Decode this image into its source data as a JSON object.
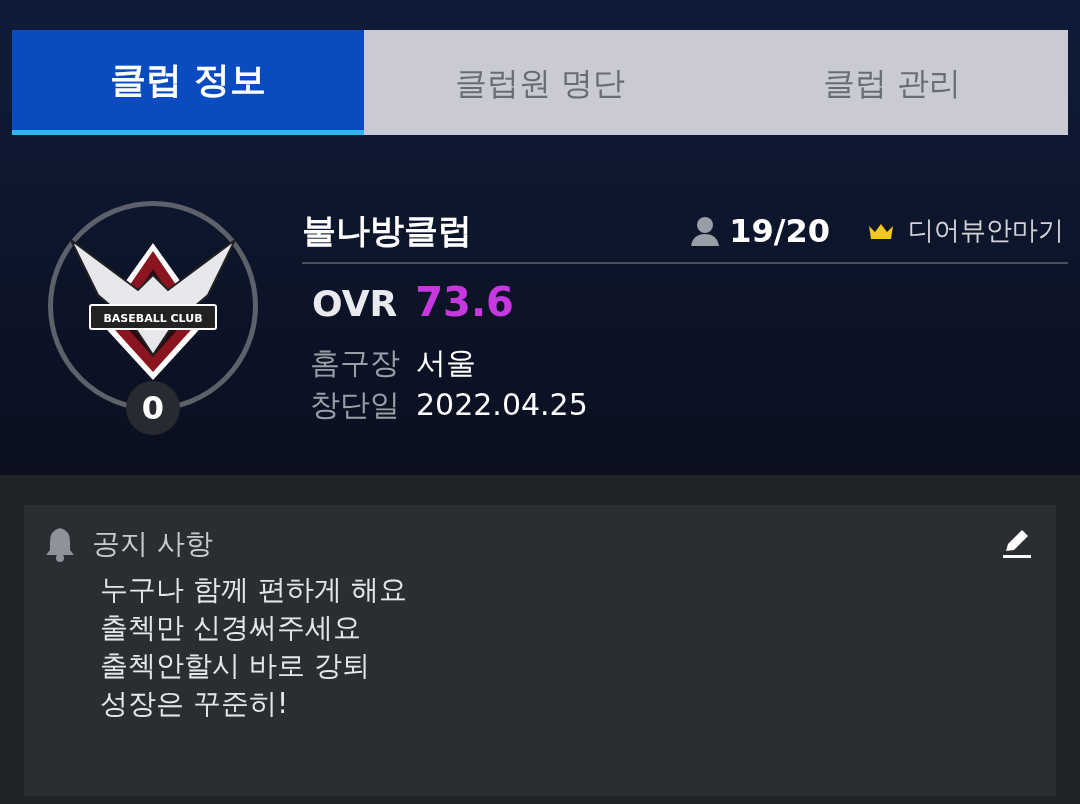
{
  "tabs": [
    {
      "label": "클럽 정보",
      "selected": true
    },
    {
      "label": "클럽원 명단",
      "selected": false
    },
    {
      "label": "클럽 관리",
      "selected": false
    }
  ],
  "club": {
    "emblem_text": "BASEBALL CLUB",
    "level": "0",
    "name": "불나방클럽",
    "members": "19/20",
    "leader": "디어뷰안마기",
    "ovr_label": "OVR",
    "ovr": "73.6",
    "details": [
      {
        "label": "홈구장",
        "value": "서울"
      },
      {
        "label": "창단일",
        "value": "2022.04.25"
      }
    ]
  },
  "notice": {
    "title": "공지 사항",
    "lines": [
      "누구나 함께 편하게 해요",
      "출첵만 신경써주세요",
      "출첵안할시 바로 강퇴",
      "성장은 꾸준히!"
    ]
  }
}
